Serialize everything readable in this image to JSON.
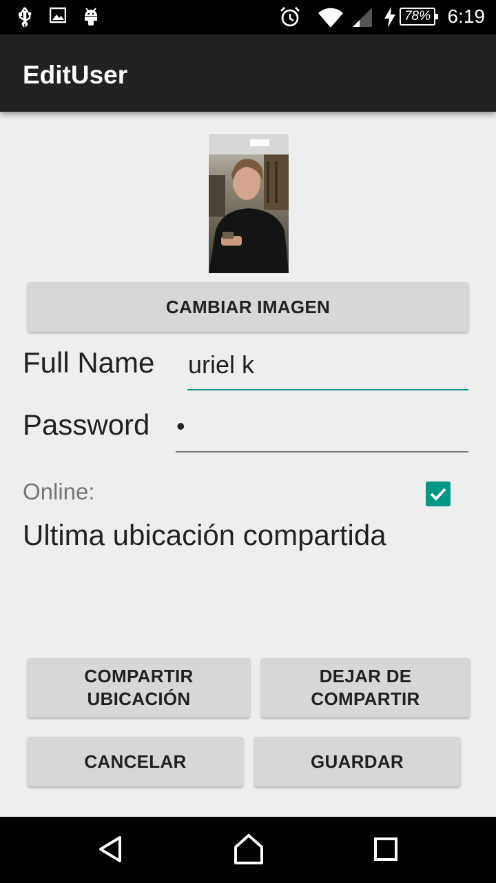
{
  "status_bar": {
    "time": "6:19",
    "battery": "78%",
    "icons": [
      "usb-icon",
      "image-icon",
      "android-icon",
      "alarm-icon",
      "wifi-icon",
      "signal-icon",
      "charging-icon"
    ]
  },
  "app_bar": {
    "title": "EditUser"
  },
  "profile": {
    "change_image_button": "CAMBIAR IMAGEN"
  },
  "form": {
    "full_name_label": "Full Name",
    "full_name_value": "uriel k",
    "password_label": "Password",
    "password_value": "•",
    "online_label": "Online:",
    "online_checked": true,
    "last_location_label": "Ultima ubicación compartida"
  },
  "actions": {
    "share_location": "COMPARTIR\nUBICACIÓN",
    "stop_sharing": "DEJAR DE\nCOMPARTIR",
    "cancel": "CANCELAR",
    "save": "GUARDAR"
  },
  "colors": {
    "accent": "#009688",
    "app_bar": "#212121",
    "background": "#eeeeee",
    "button": "#d6d7d7"
  },
  "nav_bar": {
    "icons": [
      "back-icon",
      "home-icon",
      "recents-icon"
    ]
  }
}
